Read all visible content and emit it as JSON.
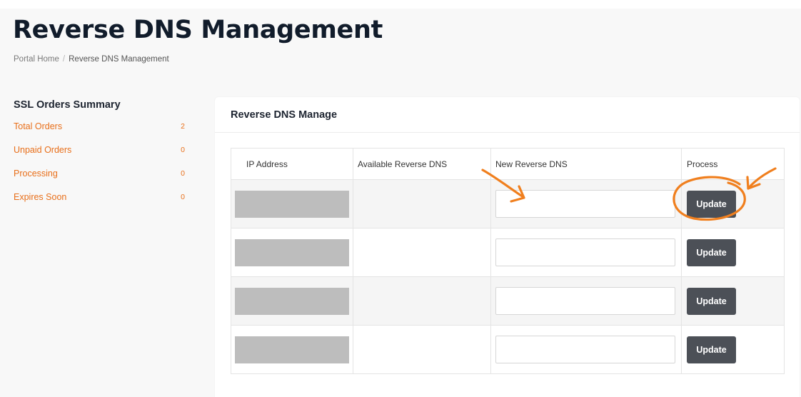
{
  "page": {
    "title": "Reverse DNS Management",
    "breadcrumb": {
      "home": "Portal Home",
      "separator": "/",
      "current": "Reverse DNS Management"
    }
  },
  "sidebar": {
    "title": "SSL Orders Summary",
    "items": [
      {
        "label": "Total Orders",
        "count": "2"
      },
      {
        "label": "Unpaid Orders",
        "count": "0"
      },
      {
        "label": "Processing",
        "count": "0"
      },
      {
        "label": "Expires Soon",
        "count": "0"
      }
    ]
  },
  "panel": {
    "title": "Reverse DNS Manage",
    "columns": [
      "IP Address",
      "Available Reverse DNS",
      "New Reverse DNS",
      "Process"
    ],
    "rows": [
      {
        "ip": "",
        "available": "",
        "new_value": "",
        "button": "Update"
      },
      {
        "ip": "",
        "available": "",
        "new_value": "",
        "button": "Update"
      },
      {
        "ip": "",
        "available": "",
        "new_value": "",
        "button": "Update"
      },
      {
        "ip": "",
        "available": "",
        "new_value": "",
        "button": "Update"
      }
    ]
  },
  "colors": {
    "accent": "#e86f1a",
    "annotation": "#f07f1e",
    "button": "#4c5057",
    "title": "#111c2b"
  }
}
